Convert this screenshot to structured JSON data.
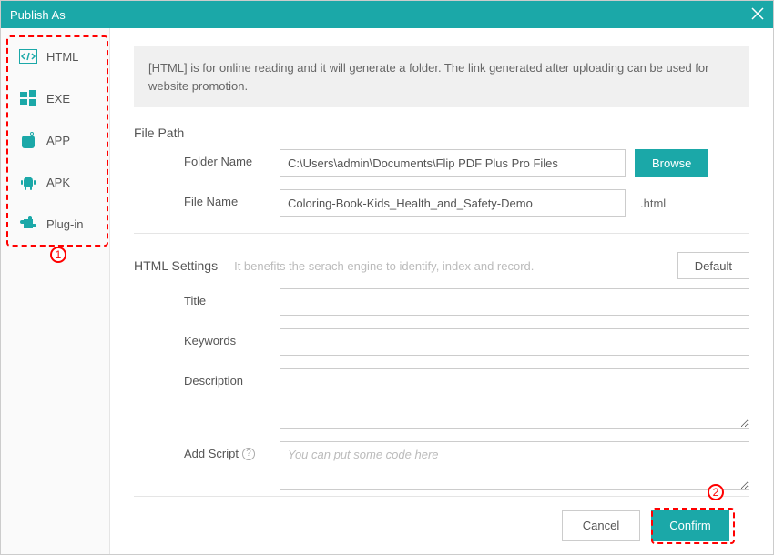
{
  "title": "Publish As",
  "sidebar": {
    "items": [
      {
        "label": "HTML"
      },
      {
        "label": "EXE"
      },
      {
        "label": "APP"
      },
      {
        "label": "APK"
      },
      {
        "label": "Plug-in"
      }
    ]
  },
  "info_text": "[HTML] is for online reading and it will generate a folder. The link generated after uploading can be used for website promotion.",
  "filepath": {
    "header": "File Path",
    "folder_label": "Folder Name",
    "folder_value": "C:\\Users\\admin\\Documents\\Flip PDF Plus Pro Files",
    "browse_label": "Browse",
    "filename_label": "File Name",
    "filename_value": "Coloring-Book-Kids_Health_and_Safety-Demo",
    "filename_suffix": ".html"
  },
  "htmlsettings": {
    "header": "HTML Settings",
    "note": "It benefits the serach engine to identify, index and record.",
    "default_label": "Default",
    "title_label": "Title",
    "title_value": "",
    "keywords_label": "Keywords",
    "keywords_value": "",
    "description_label": "Description",
    "description_value": "",
    "addscript_label": "Add Script",
    "addscript_placeholder": "You can put some code here",
    "addscript_value": ""
  },
  "footer": {
    "cancel_label": "Cancel",
    "confirm_label": "Confirm"
  },
  "annotations": {
    "num1": "1",
    "num2": "2"
  }
}
